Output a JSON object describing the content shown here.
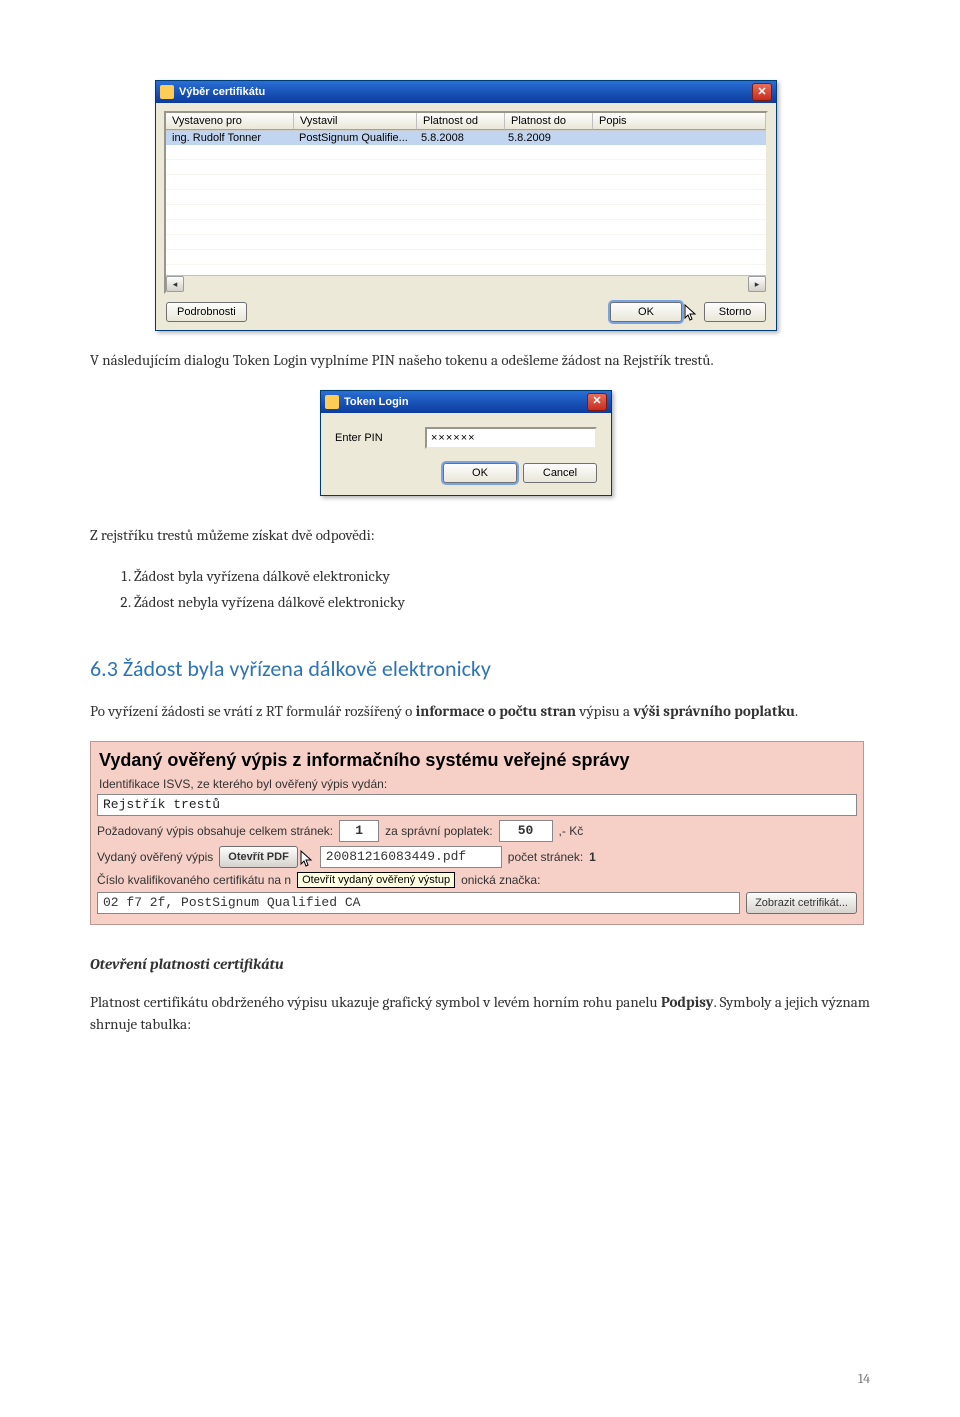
{
  "cert_dialog": {
    "title": "Výběr certifikátu",
    "headers": [
      "Vystaveno pro",
      "Vystavil",
      "Platnost od",
      "Platnost do",
      "Popis"
    ],
    "row": {
      "issued_to": "ing. Rudolf Tonner",
      "issued_by": "PostSignum Qualifie...",
      "valid_from": "5.8.2008",
      "valid_to": "5.8.2009",
      "desc": ""
    },
    "btn_details": "Podrobnosti",
    "btn_ok": "OK",
    "btn_cancel": "Storno"
  },
  "para1": "V následujícím dialogu Token Login vyplníme PIN našeho tokenu  a odešleme žádost na Rejstřík trestů.",
  "token_dialog": {
    "title": "Token Login",
    "pin_label": "Enter PIN",
    "pin_value": "××××××",
    "btn_ok": "OK",
    "btn_cancel": "Cancel"
  },
  "para2": "Z rejstříku trestů můžeme získat dvě odpovědi:",
  "answers": [
    "Žádost byla vyřízena dálkově elektronicky",
    "Žádost nebyla vyřízena dálkově elektronicky"
  ],
  "section_heading": "6.3   Žádost byla vyřízena dálkově elektronicky",
  "para3_pre": "Po vyřízení žádosti se vrátí z RT formulář rozšířený o ",
  "para3_b1": "informace o počtu stran",
  "para3_mid": " výpisu a ",
  "para3_b2": "výši správního poplatku",
  "para3_post": ".",
  "pink": {
    "title": "Vydaný ověřený výpis z informačního systému veřejné správy",
    "ident_label": "Identifikace ISVS, ze kterého byl ověřený výpis vydán:",
    "ident_value": "Rejstřík trestů",
    "pages_label": "Požadovaný výpis obsahuje celkem stránek:",
    "pages_value": "1",
    "fee_label": "za správní poplatek:",
    "fee_value": "50",
    "fee_suffix": ",- Kč",
    "issued_label": "Vydaný ověřený výpis",
    "open_pdf_btn": "Otevřít PDF",
    "pdf_name": "20081216083449.pdf",
    "page_count_label": "počet stránek:",
    "page_count_value": "1",
    "cert_num_label": "Číslo kvalifikovaného certifikátu na n",
    "tooltip": "Otevřít vydaný ověřený výstup",
    "cert_suffix": "onická značka:",
    "cert_value": "02 f7 2f, PostSignum Qualified CA",
    "show_cert_btn": "Zobrazit cetrifikát..."
  },
  "subheading": "Otevření platnosti certifikátu",
  "para4_pre": "Platnost certifikátu obdrženého výpisu ukazuje grafický symbol v levém horním rohu panelu ",
  "para4_b": "Podpisy",
  "para4_post": ". Symboly a jejich význam shrnuje tabulka:",
  "pagenum": "14"
}
